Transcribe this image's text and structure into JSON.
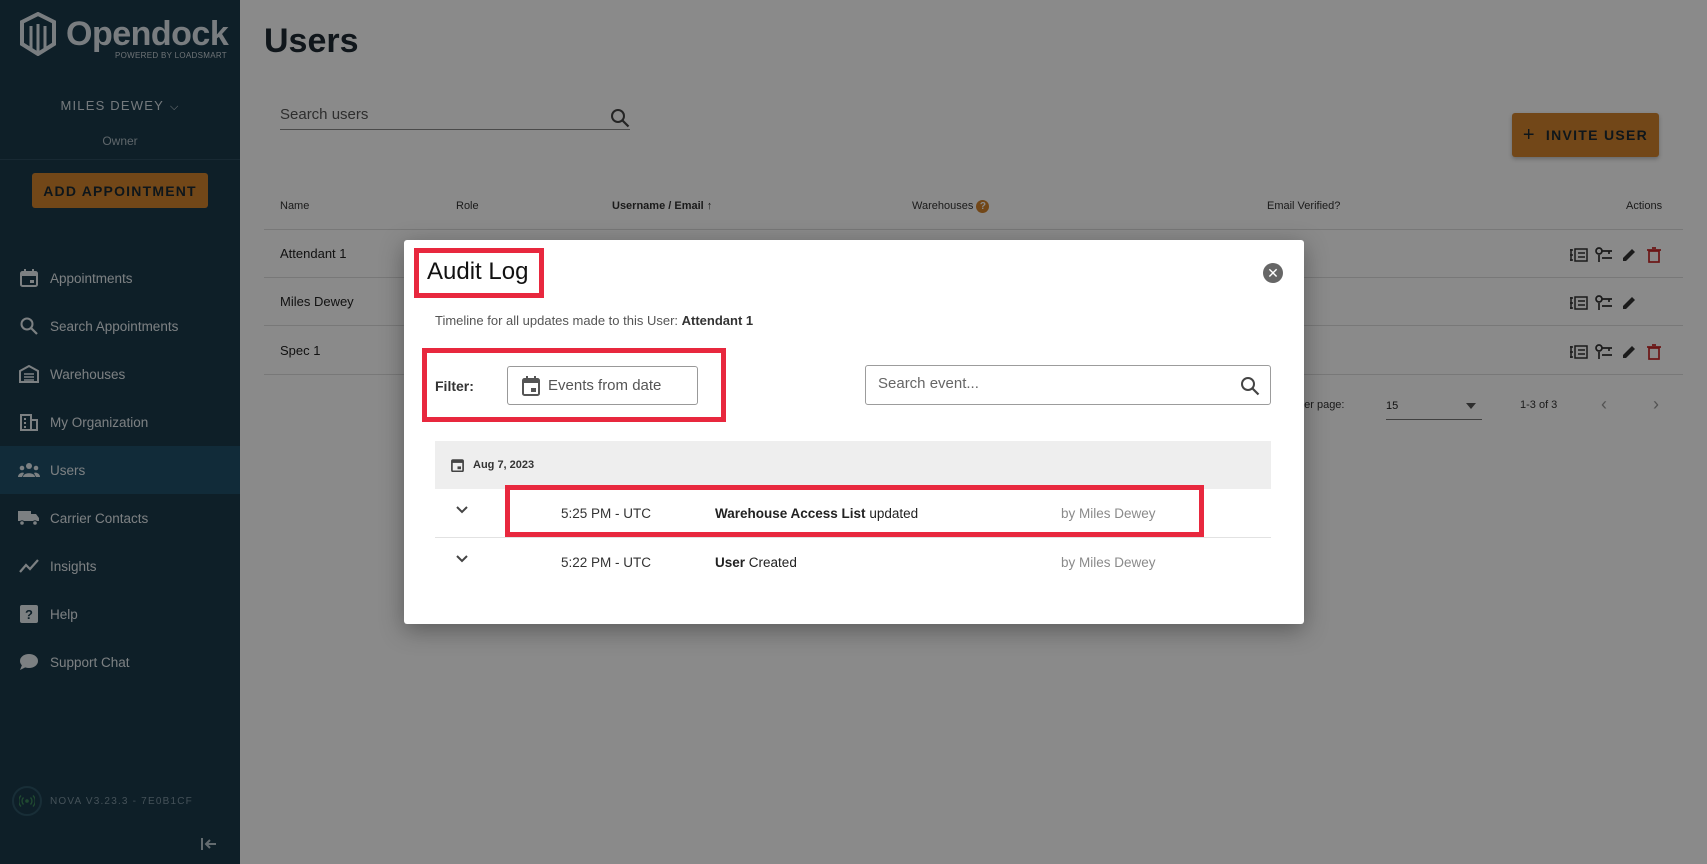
{
  "app": {
    "logo_text": "Opendock",
    "logo_sub": "POWERED BY LOADSMART",
    "user_name": "MILES DEWEY",
    "user_role": "Owner",
    "add_appointment": "ADD APPOINTMENT",
    "version": "NOVA V3.23.3 - 7E0B1CF"
  },
  "sidebar": {
    "items": [
      {
        "label": "Appointments",
        "icon": "calendar-icon"
      },
      {
        "label": "Search Appointments",
        "icon": "search-icon"
      },
      {
        "label": "Warehouses",
        "icon": "warehouse-icon"
      },
      {
        "label": "My Organization",
        "icon": "building-icon"
      },
      {
        "label": "Users",
        "icon": "users-icon",
        "active": true
      },
      {
        "label": "Carrier Contacts",
        "icon": "truck-icon"
      },
      {
        "label": "Insights",
        "icon": "chart-line-icon"
      },
      {
        "label": "Help",
        "icon": "help-icon"
      },
      {
        "label": "Support Chat",
        "icon": "chat-icon"
      }
    ]
  },
  "page": {
    "title": "Users",
    "search_placeholder": "Search users",
    "invite_label": "INVITE USER",
    "columns": {
      "name": "Name",
      "role": "Role",
      "username": "Username / Email",
      "warehouses": "Warehouses",
      "email_verified": "Email Verified?",
      "actions": "Actions"
    },
    "rows": [
      {
        "name": "Attendant 1"
      },
      {
        "name": "Miles Dewey"
      },
      {
        "name": "Spec 1"
      }
    ],
    "pager": {
      "per_page_label": "per page:",
      "per_page_value": "15",
      "range": "1-3 of 3"
    }
  },
  "modal": {
    "title": "Audit Log",
    "subtitle_prefix": "Timeline for all updates made to this User:",
    "subtitle_target": "Attendant 1",
    "filter_label": "Filter:",
    "date_placeholder": "Events from date",
    "search_placeholder": "Search event...",
    "date_group": "Aug 7, 2023",
    "events": [
      {
        "time": "5:25 PM - UTC",
        "entity": "Warehouse Access List",
        "action": "updated",
        "by": "by Miles Dewey"
      },
      {
        "time": "5:22 PM - UTC",
        "entity": "User",
        "action": "Created",
        "by": "by Miles Dewey"
      }
    ]
  },
  "colors": {
    "sidebar_bg": "#1b3a4b",
    "accent": "#d3842d",
    "highlight": "#e8283e"
  }
}
